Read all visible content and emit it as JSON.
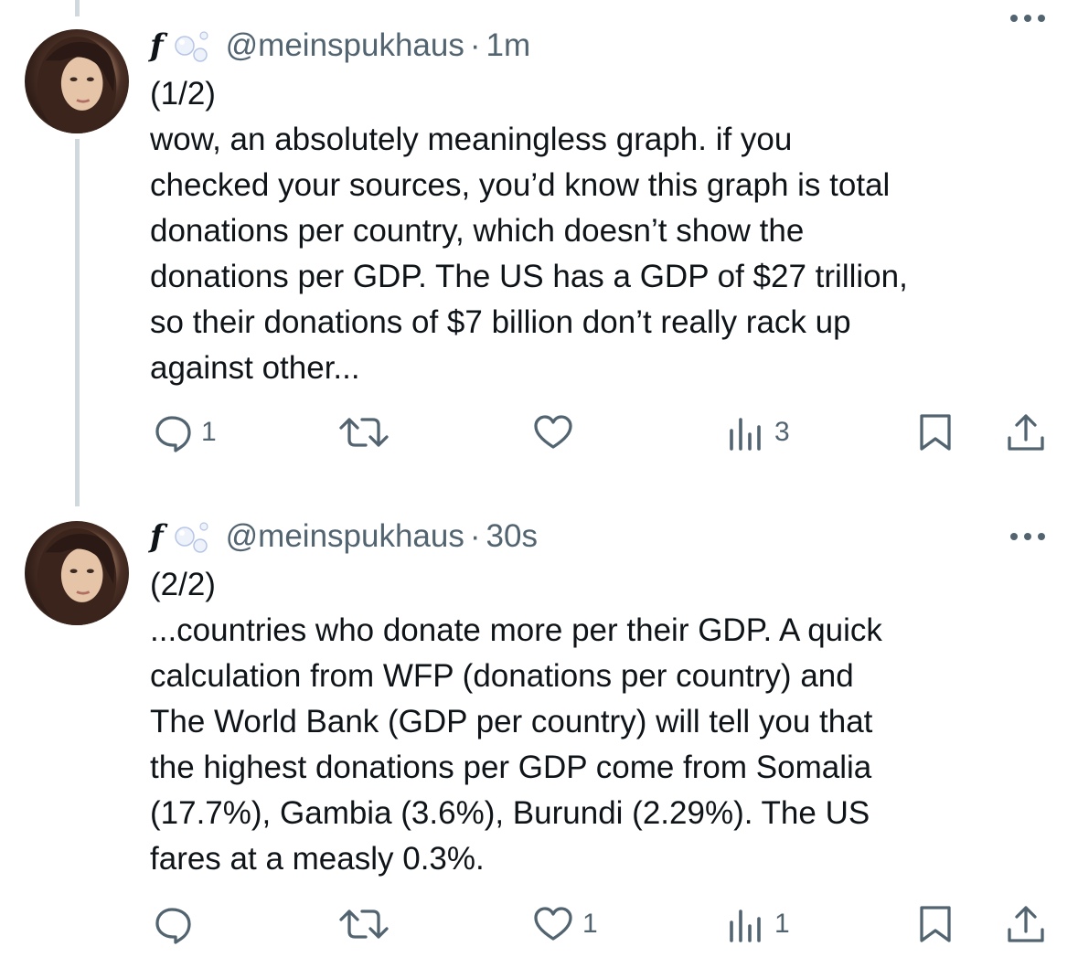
{
  "tweets": [
    {
      "display_name": "f",
      "handle": "@meinspukhaus",
      "separator": "·",
      "time": "1m",
      "more_label": "•••",
      "counter": "(1/2)",
      "text": "wow, an absolutely meaningless graph. if you\nchecked your sources, you’d know this graph is total\ndonations per country, which doesn’t show the\ndonations per GDP. The US has a GDP of $27 trillion,\nso their donations of $7 billion don’t really rack up\nagainst other...",
      "replies": "1",
      "reposts": "",
      "likes": "",
      "views": "3"
    },
    {
      "display_name": "f",
      "handle": "@meinspukhaus",
      "separator": "·",
      "time": "30s",
      "more_label": "•••",
      "counter": "(2/2)",
      "text": "...countries who donate more per their GDP. A quick\ncalculation from WFP (donations per country) and\nThe World Bank (GDP per country) will tell you that\nthe highest donations per GDP come from Somalia\n(17.7%), Gambia (3.6%), Burundi (2.29%). The US\nfares at a measly 0.3%.",
      "replies": "",
      "reposts": "",
      "likes": "1",
      "views": "1"
    }
  ],
  "icons": {
    "reply": "reply-icon",
    "repost": "repost-icon",
    "like": "heart-icon",
    "views": "views-icon",
    "bookmark": "bookmark-icon",
    "share": "share-icon"
  },
  "colors": {
    "text": "#0f1419",
    "muted": "#536471",
    "thread_line": "#cfd9de"
  }
}
